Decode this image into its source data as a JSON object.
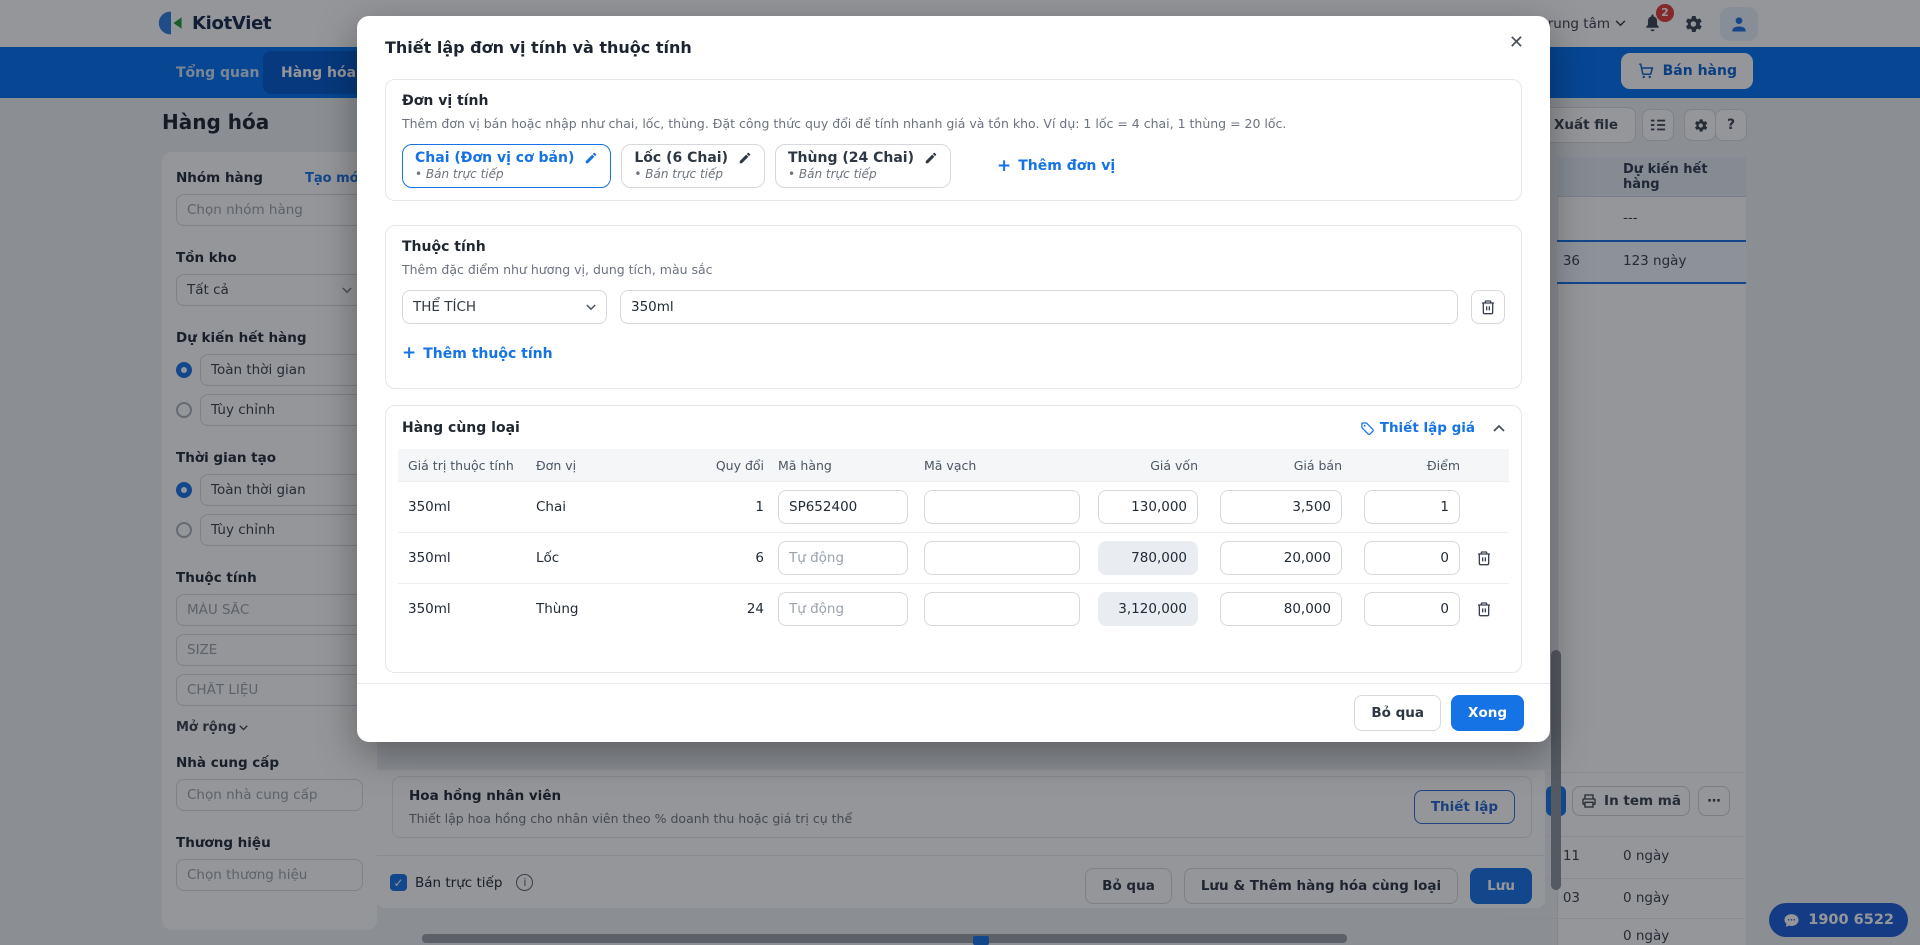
{
  "topbar": {
    "logo_text": "KiotViet",
    "branch_label": "trung tâm",
    "notification_badge": "2"
  },
  "navbar": {
    "items": [
      {
        "label": "Tổng quan"
      },
      {
        "label": "Hàng hóa"
      }
    ],
    "sell_button_label": "Bán hàng"
  },
  "filters": {
    "page_title": "Hàng hóa",
    "product_group": {
      "label": "Nhóm hàng",
      "action_link": "Tạo mới",
      "placeholder": "Chọn nhóm hàng"
    },
    "inventory": {
      "label": "Tồn kho",
      "value": "Tất cả"
    },
    "stockout_forecast": {
      "label": "Dự kiến hết hàng",
      "options": [
        "Toàn thời gian",
        "Tùy chỉnh"
      ],
      "selected": "Toàn thời gian"
    },
    "created_time": {
      "label": "Thời gian tạo",
      "options": [
        "Toàn thời gian",
        "Tùy chỉnh"
      ],
      "selected": "Toàn thời gian"
    },
    "attributes": {
      "label": "Thuộc tính",
      "fields": [
        "MÀU SẮC",
        "SIZE",
        "CHẤT LIỆU"
      ],
      "expand_link": "Mở rộng"
    },
    "supplier": {
      "label": "Nhà cung cấp",
      "placeholder": "Chọn nhà cung cấp"
    },
    "brand": {
      "label": "Thương hiệu",
      "placeholder": "Chọn thương hiệu"
    }
  },
  "product_table": {
    "export_button": "Xuất file",
    "column_header": "Dự kiến hết hàng",
    "row_empty_forecast": "---",
    "selected_row": {
      "stock": "36",
      "forecast": "123 ngày"
    },
    "bottom_rows": [
      {
        "stock": "11",
        "forecast": "0 ngày"
      },
      {
        "stock": "03",
        "forecast": "0 ngày"
      },
      {
        "stock": "",
        "forecast": "0 ngày"
      }
    ],
    "print_label_button": "In tem mã",
    "more_button": "⋯"
  },
  "detail_panel": {
    "commission": {
      "title": "Hoa hồng nhân viên",
      "description": "Thiết lập hoa hồng cho nhân viên theo % doanh thu hoặc giá trị cụ thể",
      "setup_button": "Thiết lập"
    },
    "direct_sale_checkbox": "Bán trực tiếp",
    "buttons": {
      "skip": "Bỏ qua",
      "save_and_add": "Lưu & Thêm hàng hóa cùng loại",
      "save": "Lưu"
    }
  },
  "support_chat": {
    "phone": "1900 6522"
  },
  "modal": {
    "title": "Thiết lập đơn vị tính và thuộc tính",
    "units": {
      "title": "Đơn vị tính",
      "description": "Thêm đơn vị bán hoặc nhập như chai, lốc, thùng. Đặt công thức quy đổi để tính nhanh giá và tồn kho. Ví dụ: 1 lốc = 4 chai, 1 thùng = 20 lốc.",
      "items": [
        {
          "name": "Chai (Đơn vị cơ bản)",
          "note": "Bán trực tiếp"
        },
        {
          "name": "Lốc (6 Chai)",
          "note": "Bán trực tiếp"
        },
        {
          "name": "Thùng (24 Chai)",
          "note": "Bán trực tiếp"
        }
      ],
      "add_button": "Thêm đơn vị"
    },
    "attributes": {
      "title": "Thuộc tính",
      "description": "Thêm đặc điểm như hương vị, dung tích, màu sắc",
      "name_value": "THỂ TÍCH",
      "value": "350ml",
      "add_button": "Thêm thuộc tính"
    },
    "variants": {
      "title": "Hàng cùng loại",
      "price_setup_link": "Thiết lập giá",
      "columns": [
        "Giá trị thuộc tính",
        "Đơn vị",
        "Quy đổi",
        "Mã hàng",
        "Mã vạch",
        "Giá vốn",
        "Giá bán",
        "Điểm"
      ],
      "rows": [
        {
          "attribute": "350ml",
          "unit": "Chai",
          "conversion": "1",
          "code": "SP652400",
          "code_placeholder": "",
          "barcode": "",
          "cost": "130,000",
          "price": "3,500",
          "points": "1"
        },
        {
          "attribute": "350ml",
          "unit": "Lốc",
          "conversion": "6",
          "code": "",
          "code_placeholder": "Tự động",
          "barcode": "",
          "cost": "780,000",
          "price": "20,000",
          "points": "0"
        },
        {
          "attribute": "350ml",
          "unit": "Thùng",
          "conversion": "24",
          "code": "",
          "code_placeholder": "Tự động",
          "barcode": "",
          "cost": "3,120,000",
          "price": "80,000",
          "points": "0"
        }
      ]
    },
    "footer": {
      "skip_button": "Bỏ qua",
      "done_button": "Xong"
    }
  }
}
